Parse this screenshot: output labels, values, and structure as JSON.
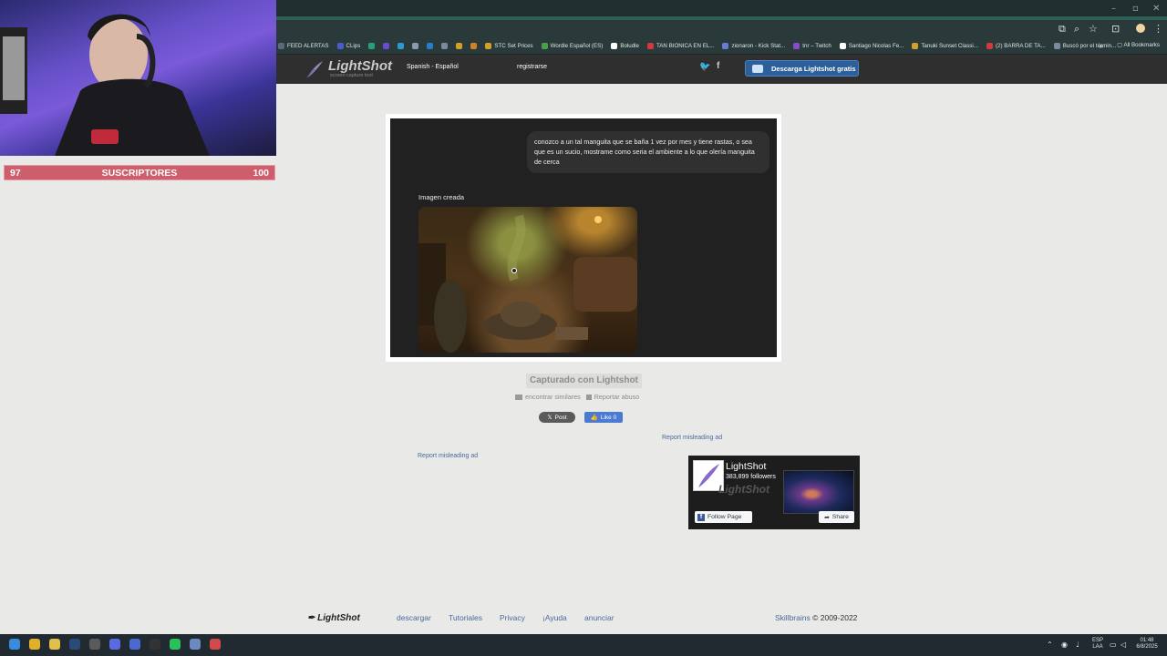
{
  "browser": {
    "toolbar_icons": [
      "⧉",
      "⌕",
      "☆",
      "⊡",
      "⋮"
    ],
    "window_controls": [
      "–",
      "▫",
      "✕"
    ],
    "bookmarks": [
      {
        "label": "FEED ALERTAS",
        "color": "#5a6a7a"
      },
      {
        "label": "CLips",
        "color": "#4a5ad0"
      },
      {
        "label": "",
        "color": "#29a07a"
      },
      {
        "label": "",
        "color": "#6a4ad0"
      },
      {
        "label": "",
        "color": "#2a9ad0"
      },
      {
        "label": "",
        "color": "#8a9aaa"
      },
      {
        "label": "",
        "color": "#2a7ad0"
      },
      {
        "label": "",
        "color": "#7a8a9a"
      },
      {
        "label": "",
        "color": "#d0a02a"
      },
      {
        "label": "",
        "color": "#d0802a"
      },
      {
        "label": "STC Set Prices",
        "color": "#d0a02a"
      },
      {
        "label": "Wordle Español (ES)",
        "color": "#4aa04a"
      },
      {
        "label": "Boludle",
        "color": "#ffffff"
      },
      {
        "label": "TAN BIONICA EN EL...",
        "color": "#d03a3a"
      },
      {
        "label": "zionaron - Kick Stat...",
        "color": "#6a7ad0"
      },
      {
        "label": "tnr – Twitch",
        "color": "#8a4ad0"
      },
      {
        "label": "Santiago Nicolas Fe...",
        "color": "#ffffff"
      },
      {
        "label": "Tanuki Sunset Classi...",
        "color": "#d0a02a"
      },
      {
        "label": "(2) BARRA DE TA...",
        "color": "#d03a3a"
      },
      {
        "label": "Buscó por el términ...",
        "color": "#7a8a9a"
      }
    ],
    "bookmarks_more": "»",
    "all_bookmarks": "All Bookmarks"
  },
  "header": {
    "logo_name": "LightShot",
    "logo_tag": "screen capture tool",
    "language": "Spanish - Español",
    "register": "registrarse",
    "twitter_icon": "🐦",
    "facebook_icon": "f",
    "download_label": "Descarga Lightshot gratis"
  },
  "overlay": {
    "sub_left": "97",
    "sub_label": "SUSCRIPTORES",
    "sub_right": "100",
    "sub_progress": 0.97
  },
  "screenshot": {
    "message": "conozco a un tal manguita que se baña 1 vez por mes y tiene rastas, o sea que es un sucio, mostrame como seria el ambiente a lo que olería manguita de cerca",
    "image_label": "Imagen creada"
  },
  "page": {
    "captured": "Capturado con Lightshot",
    "find_similar": "encontrar similares",
    "report_abuse": "Reportar abuso",
    "post_label": "Post",
    "like_label": "Like 0",
    "report_ad": "Report misleading ad"
  },
  "fb_widget": {
    "name": "LightShot",
    "followers": "383,899 followers",
    "watermark": "LightShot",
    "follow_label": "Follow Page",
    "share_label": "Share"
  },
  "footer": {
    "logo": "LightShot",
    "links": [
      "descargar",
      "Tutoriales",
      "Privacy",
      "¡Ayuda",
      "anunciar"
    ],
    "company": "Skillbrains",
    "copyright": "© 2009-2022"
  },
  "taskbar": {
    "apps": [
      {
        "name": "windows-start",
        "color": "#3a8ae0"
      },
      {
        "name": "chrome",
        "color": "#e0b02a"
      },
      {
        "name": "file-explorer",
        "color": "#e0c04a"
      },
      {
        "name": "steam",
        "color": "#2a4a7a"
      },
      {
        "name": "obs",
        "color": "#5a5a5a"
      },
      {
        "name": "discord",
        "color": "#5a6ae0"
      },
      {
        "name": "app-window",
        "color": "#4a6ad0"
      },
      {
        "name": "capcut",
        "color": "#333333"
      },
      {
        "name": "spotify",
        "color": "#2ac05a"
      },
      {
        "name": "gamepad",
        "color": "#6a8ac0"
      },
      {
        "name": "recorder",
        "color": "#d04a4a"
      }
    ],
    "lang_top": "ESP",
    "lang_bottom": "LAA",
    "time": "01:48",
    "date": "6/8/2025"
  }
}
